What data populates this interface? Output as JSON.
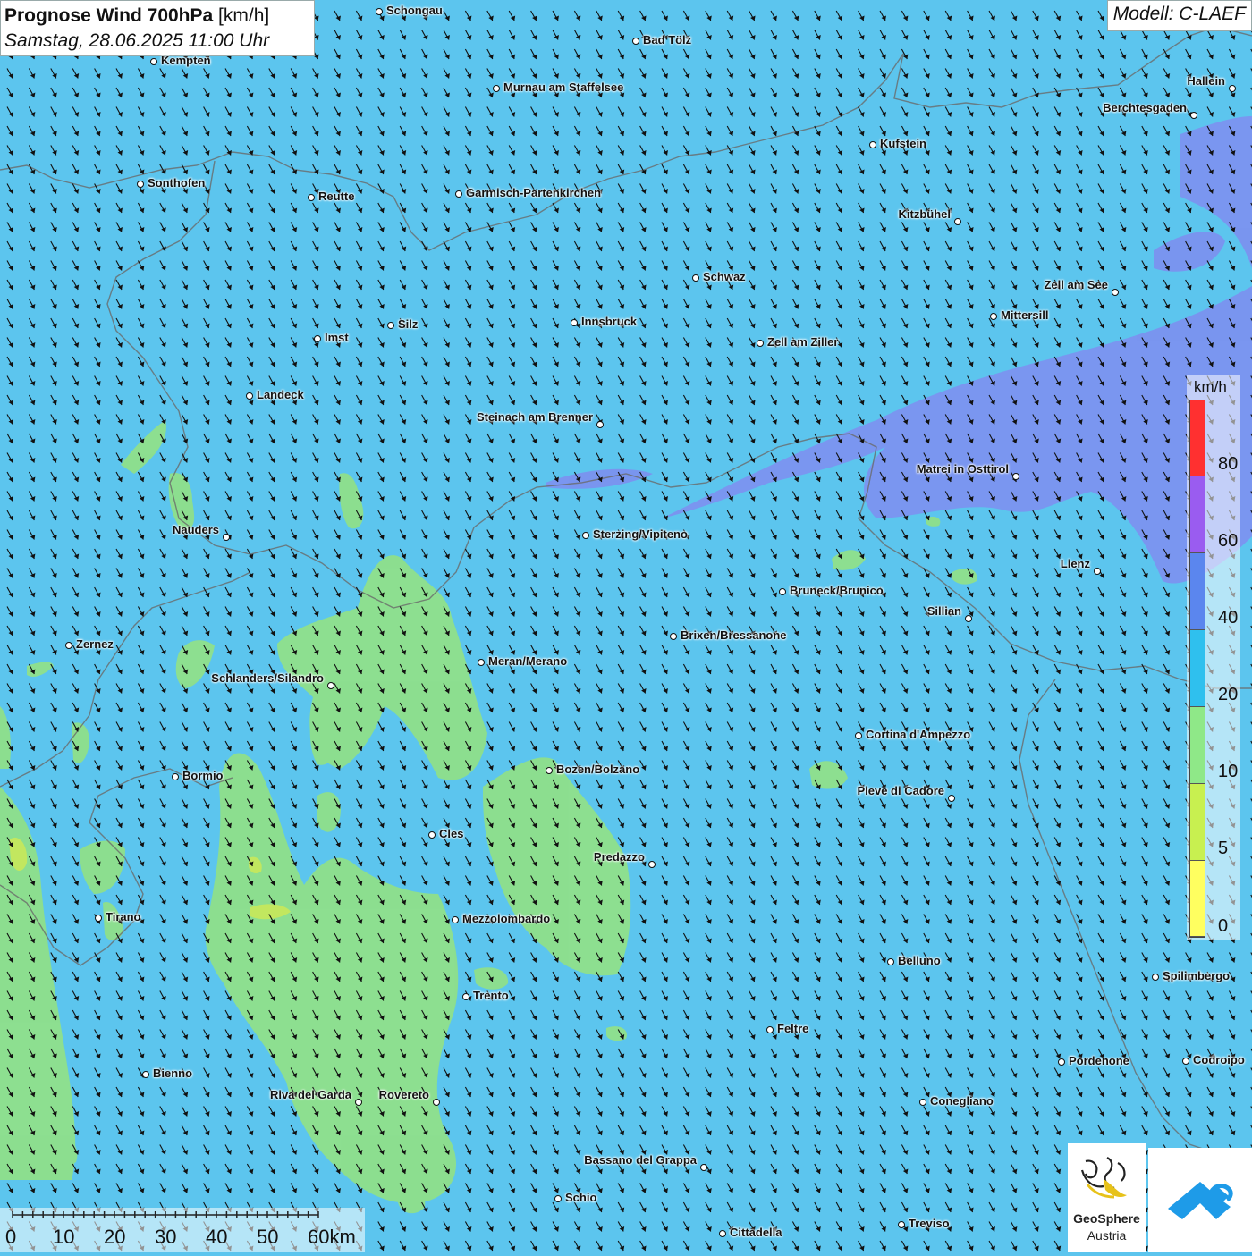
{
  "header": {
    "title_bold": "Prognose Wind 700hPa",
    "title_unit": "[km/h]",
    "subtitle": "Samstag, 28.06.2025 11:00 Uhr",
    "model": "Modell: C-LAEF"
  },
  "colors": {
    "base_wind": "#5cc5ee",
    "zone_10_20": "#8fe08a",
    "zone_5_10": "#c8e85a",
    "zone_40_60": "#7f8df0",
    "border": "#666666"
  },
  "cities": [
    {
      "name": "Schongau",
      "dot": "left"
    },
    {
      "name": "Bad Tölz",
      "dot": "left"
    },
    {
      "name": "Kempten",
      "dot": "left"
    },
    {
      "name": "Murnau am Staffelsee",
      "dot": "left"
    },
    {
      "name": "Hallein",
      "dot": "right"
    },
    {
      "name": "Berchtesgaden",
      "dot": "right"
    },
    {
      "name": "Kufstein",
      "dot": "left"
    },
    {
      "name": "Sonthofen",
      "dot": "left"
    },
    {
      "name": "Reutte",
      "dot": "left"
    },
    {
      "name": "Garmisch-Partenkirchen",
      "dot": "left"
    },
    {
      "name": "Kitzbühel",
      "dot": "right"
    },
    {
      "name": "Schwaz",
      "dot": "left"
    },
    {
      "name": "Zell am See",
      "dot": "right"
    },
    {
      "name": "Innsbruck",
      "dot": "left"
    },
    {
      "name": "Mittersill",
      "dot": "left"
    },
    {
      "name": "Silz",
      "dot": "left"
    },
    {
      "name": "Imst",
      "dot": "left"
    },
    {
      "name": "Zell am Ziller",
      "dot": "left"
    },
    {
      "name": "Landeck",
      "dot": "left"
    },
    {
      "name": "Steinach am Brenner",
      "dot": "right"
    },
    {
      "name": "Matrei in Osttirol",
      "dot": "right"
    },
    {
      "name": "Nauders",
      "dot": "right"
    },
    {
      "name": "Sterzing/Vipiteno",
      "dot": "left"
    },
    {
      "name": "Lienz",
      "dot": "right"
    },
    {
      "name": "Bruneck/Brunico",
      "dot": "left"
    },
    {
      "name": "Sillian",
      "dot": "right"
    },
    {
      "name": "Brixen/Bressanone",
      "dot": "left"
    },
    {
      "name": "Zernez",
      "dot": "left"
    },
    {
      "name": "Meran/Merano",
      "dot": "left"
    },
    {
      "name": "Schlanders/Silandro",
      "dot": "right"
    },
    {
      "name": "Cortina d'Ampezzo",
      "dot": "left"
    },
    {
      "name": "Bozen/Bolzano",
      "dot": "left"
    },
    {
      "name": "Bormio",
      "dot": "left"
    },
    {
      "name": "Pieve di Cadore",
      "dot": "right"
    },
    {
      "name": "Cles",
      "dot": "left"
    },
    {
      "name": "Predazzo",
      "dot": "right"
    },
    {
      "name": "Tirano",
      "dot": "left"
    },
    {
      "name": "Mezzolombardo",
      "dot": "left"
    },
    {
      "name": "Belluno",
      "dot": "left"
    },
    {
      "name": "Spilimbergo",
      "dot": "left"
    },
    {
      "name": "Trento",
      "dot": "left"
    },
    {
      "name": "Feltre",
      "dot": "left"
    },
    {
      "name": "Pordenone",
      "dot": "left"
    },
    {
      "name": "Codroipo",
      "dot": "left"
    },
    {
      "name": "Bienno",
      "dot": "left"
    },
    {
      "name": "Riva del Garda",
      "dot": "right"
    },
    {
      "name": "Rovereto",
      "dot": "right"
    },
    {
      "name": "Conegliano",
      "dot": "left"
    },
    {
      "name": "Bassano del Grappa",
      "dot": "right"
    },
    {
      "name": "Schio",
      "dot": "left"
    },
    {
      "name": "Treviso",
      "dot": "left"
    },
    {
      "name": "Cittadella",
      "dot": "left"
    }
  ],
  "legend": {
    "unit": "km/h",
    "ticks": [
      "80",
      "60",
      "40",
      "20",
      "10",
      "5",
      "0"
    ],
    "bands": [
      {
        "label": "80+",
        "color": "#ff3030"
      },
      {
        "label": "60-80",
        "color": "#9a5cf0"
      },
      {
        "label": "40-60",
        "color": "#5b86ee"
      },
      {
        "label": "20-40",
        "color": "#2fc0ee"
      },
      {
        "label": "10-20",
        "color": "#8fe888"
      },
      {
        "label": "5-10",
        "color": "#c8f050"
      },
      {
        "label": "0-5",
        "color": "#ffff60"
      }
    ]
  },
  "scalebar": {
    "labels": [
      "0",
      "10",
      "20",
      "30",
      "40",
      "50",
      "60km"
    ]
  },
  "logos": {
    "geosphere_line1": "GeoSphere",
    "geosphere_line2": "Austria"
  }
}
